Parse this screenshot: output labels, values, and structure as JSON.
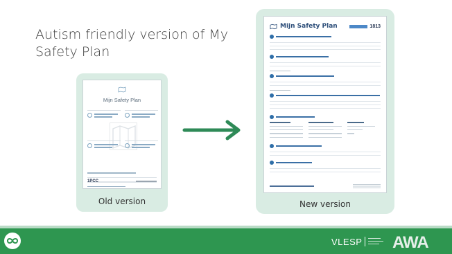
{
  "slide": {
    "title": "Autism friendly version of My Safety Plan"
  },
  "old_card": {
    "label": "Old version",
    "document_title": "Mijn Safety Plan"
  },
  "new_card": {
    "label": "New version",
    "document_title": "Mijn Safety Plan",
    "badge_number": "1813"
  },
  "footer": {
    "vlesp": "VLESP",
    "awa": "AWA"
  },
  "icons": [
    "loop-icon",
    "map-icon",
    "arrow-right-icon"
  ],
  "colors": {
    "accent_green": "#2e9650",
    "card_bg": "#d9ece3",
    "arrow": "#2e8a57"
  }
}
